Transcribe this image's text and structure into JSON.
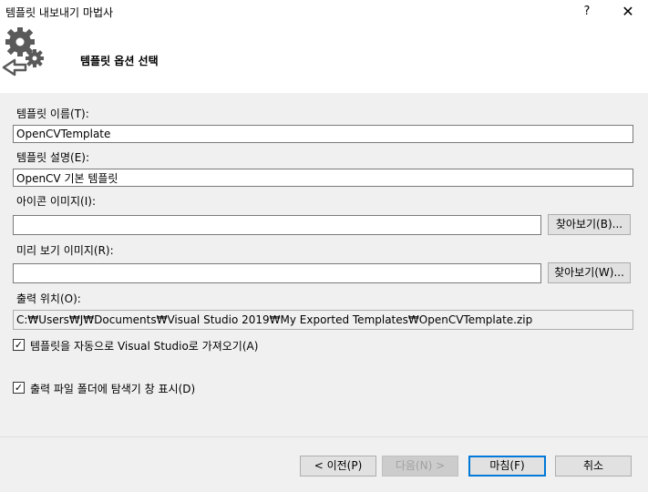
{
  "window": {
    "title": "템플릿 내보내기 마법사",
    "help_label": "?",
    "close_label": "✕"
  },
  "header": {
    "title": "템플릿 옵션 선택",
    "logo_icon": "gear-export-icon"
  },
  "form": {
    "template_name_label": "템플릿 이름(T):",
    "template_name_value": "OpenCVTemplate",
    "template_desc_label": "템플릿 설명(E):",
    "template_desc_value": "OpenCV 기본 템플릿",
    "icon_image_label": "아이콘 이미지(I):",
    "icon_image_value": "",
    "icon_browse_label": "찾아보기(B)...",
    "preview_image_label": "미리 보기 이미지(R):",
    "preview_image_value": "",
    "preview_browse_label": "찾아보기(W)...",
    "output_location_label": "출력 위치(O):",
    "output_location_value": "C:₩Users₩J₩Documents₩Visual Studio 2019₩My Exported Templates₩OpenCVTemplate.zip",
    "auto_import_label": "템플릿을 자동으로 Visual Studio로 가져오기(A)",
    "auto_import_checked": true,
    "show_explorer_label": "출력 파일 폴더에 탐색기 창 표시(D)",
    "show_explorer_checked": true,
    "check_glyph": "✓"
  },
  "footer": {
    "prev_label": "< 이전(P)",
    "next_label": "다음(N) >",
    "finish_label": "마침(F)",
    "cancel_label": "취소"
  },
  "colors": {
    "content_bg": "#f0f0f0",
    "primary_border": "#0078d7",
    "logo_gray": "#5a5a5a"
  }
}
